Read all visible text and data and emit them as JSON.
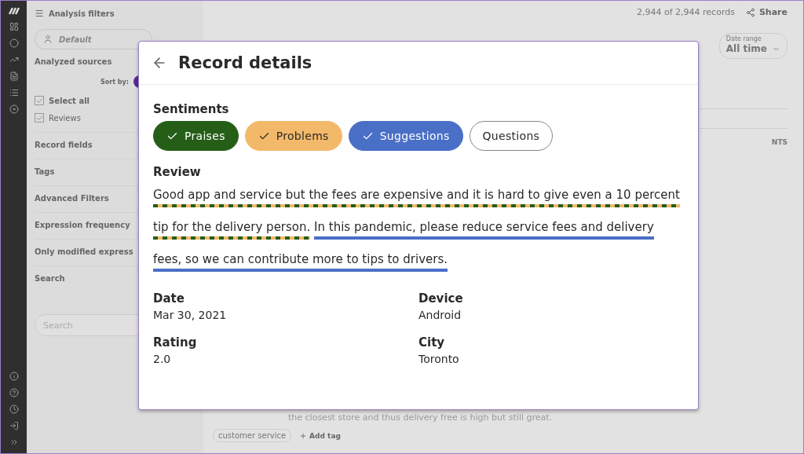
{
  "filters": {
    "title": "Analysis filters",
    "profile": "Default",
    "analyzed_sources": "Analyzed sources",
    "sort_by": "Sort by:",
    "sources": [
      {
        "label": "Select all",
        "checked": true
      },
      {
        "label": "Reviews",
        "checked": true
      }
    ],
    "sections": [
      "Record fields",
      "Tags",
      "Advanced Filters",
      "Expression frequency",
      "Only modified express",
      "Search"
    ],
    "search": {
      "placeholder": "Search"
    }
  },
  "main": {
    "records": "2,944 of 2,944 records",
    "share": "Share",
    "date_range": {
      "label": "Date range",
      "value": "All time"
    },
    "column_header": "NTS",
    "comment": "the closest store and thus delivery free is high but still great.",
    "tags": [
      "customer service"
    ],
    "add_tag": "Add tag"
  },
  "dialog": {
    "title": "Record details",
    "sentiments_label": "Sentiments",
    "sentiments": [
      {
        "label": "Praises",
        "selected": true,
        "color": "#255e17"
      },
      {
        "label": "Problems",
        "selected": true,
        "color": "#f3b96a"
      },
      {
        "label": "Suggestions",
        "selected": true,
        "color": "#4a6fc7"
      },
      {
        "label": "Questions",
        "selected": false,
        "color": "#ffffff"
      }
    ],
    "review_label": "Review",
    "review": [
      {
        "text": "Good app and service but the fees are expensive and it is hard to give even a 10 percent tip for the delivery person.",
        "kind": "mixed"
      },
      {
        "text": "In this pandemic, please reduce service fees and delivery fees, so we can contribute more to tips to drivers.",
        "kind": "suggestion"
      }
    ],
    "fields": [
      {
        "label": "Date",
        "value": "Mar 30, 2021"
      },
      {
        "label": "Device",
        "value": "Android"
      },
      {
        "label": "Rating",
        "value": "2.0"
      },
      {
        "label": "City",
        "value": "Toronto"
      }
    ]
  }
}
